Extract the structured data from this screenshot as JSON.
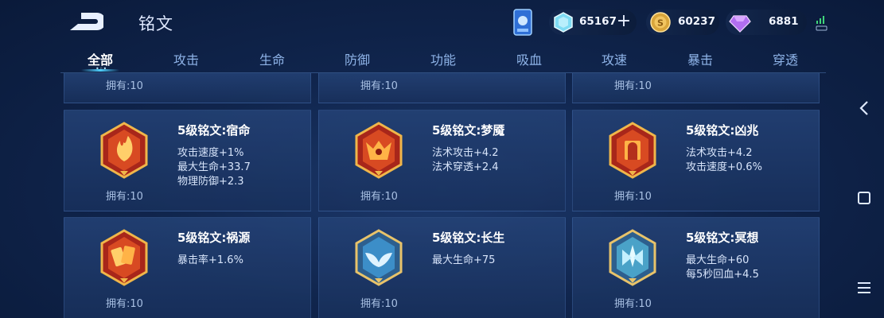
{
  "header": {
    "title": "铭文"
  },
  "currency": {
    "crystal": "65167",
    "gold": "60237",
    "gem": "6881"
  },
  "tabs": [
    {
      "label": "全部",
      "active": true
    },
    {
      "label": "攻击"
    },
    {
      "label": "生命"
    },
    {
      "label": "防御"
    },
    {
      "label": "功能"
    },
    {
      "label": "吸血"
    },
    {
      "label": "攻速"
    },
    {
      "label": "暴击"
    },
    {
      "label": "穿透"
    }
  ],
  "top_row_owned": [
    "拥有:10",
    "拥有:10",
    "拥有:10"
  ],
  "runes": [
    {
      "name": "5级铭文:宿命",
      "stats": [
        "攻击速度+1%",
        "最大生命+33.7",
        "物理防御+2.3"
      ],
      "owned": "拥有:10",
      "color": "red",
      "icon": "flame-emblem-icon"
    },
    {
      "name": "5级铭文:梦魇",
      "stats": [
        "法术攻击+4.2",
        "法术穿透+2.4"
      ],
      "owned": "拥有:10",
      "color": "red",
      "icon": "demon-emblem-icon"
    },
    {
      "name": "5级铭文:凶兆",
      "stats": [
        "法术攻击+4.2",
        "攻击速度+0.6%"
      ],
      "owned": "拥有:10",
      "color": "red",
      "icon": "gate-emblem-icon"
    },
    {
      "name": "5级铭文:祸源",
      "stats": [
        "暴击率+1.6%"
      ],
      "owned": "拥有:10",
      "color": "red",
      "icon": "cards-emblem-icon"
    },
    {
      "name": "5级铭文:长生",
      "stats": [
        "最大生命+75"
      ],
      "owned": "拥有:10",
      "color": "blue",
      "icon": "whale-tail-emblem-icon"
    },
    {
      "name": "5级铭文:冥想",
      "stats": [
        "最大生命+60",
        "每5秒回血+4.5"
      ],
      "owned": "拥有:10",
      "color": "blue",
      "icon": "lotus-emblem-icon"
    }
  ],
  "colors": {
    "background": "#10254d",
    "accent": "#4fd0ff",
    "red_emblem": "#d2461e",
    "blue_emblem": "#3c8ec8",
    "gold_frame": "#e8b24a"
  }
}
